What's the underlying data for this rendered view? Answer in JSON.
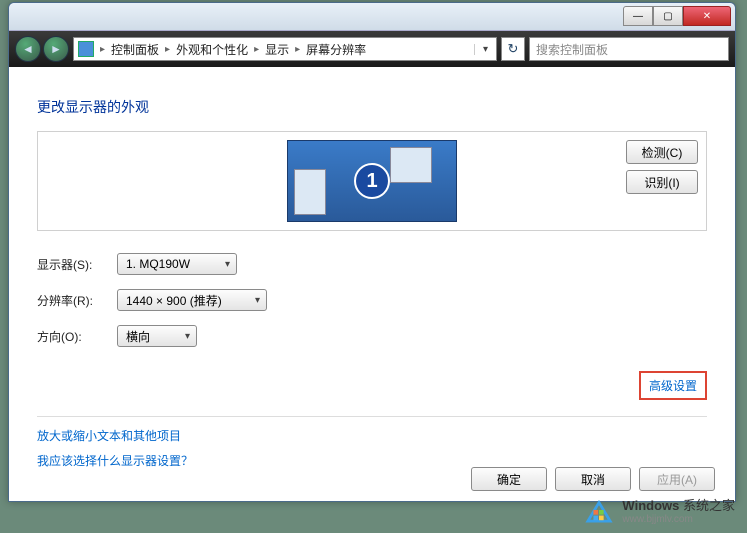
{
  "breadcrumb": {
    "items": [
      "控制面板",
      "外观和个性化",
      "显示",
      "屏幕分辨率"
    ]
  },
  "search": {
    "placeholder": "搜索控制面板"
  },
  "page": {
    "title": "更改显示器的外观"
  },
  "preview": {
    "monitor_number": "1",
    "detect_btn": "检测(C)",
    "identify_btn": "识别(I)"
  },
  "form": {
    "display_label": "显示器(S):",
    "display_value": "1. MQ190W",
    "resolution_label": "分辨率(R):",
    "resolution_value": "1440 × 900 (推荐)",
    "orientation_label": "方向(O):",
    "orientation_value": "横向"
  },
  "links": {
    "advanced": "高级设置",
    "text_size": "放大或缩小文本和其他项目",
    "which_display": "我应该选择什么显示器设置？"
  },
  "buttons": {
    "ok": "确定",
    "cancel": "取消",
    "apply": "应用(A)"
  },
  "watermark": {
    "brand": "Windows",
    "suffix": "系统之家",
    "url": "www.bjjmlv.com"
  }
}
